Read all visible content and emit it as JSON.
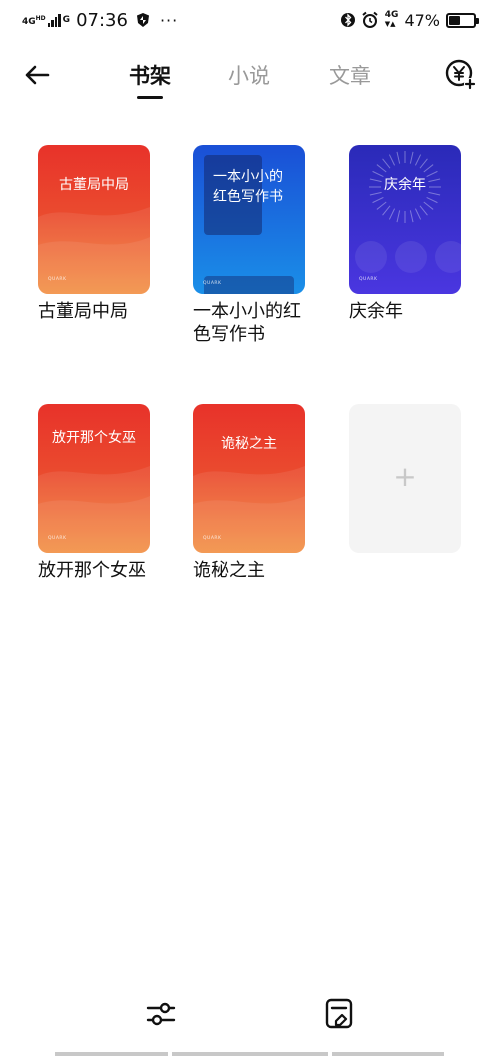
{
  "status_bar": {
    "network": "4G",
    "network_sup": "HD",
    "network2": "G",
    "time": "07:36",
    "dots": "···",
    "net_right": "4G",
    "battery": "47%",
    "battery_level": 0.47
  },
  "header": {
    "tabs": [
      "书架",
      "小说",
      "文章"
    ],
    "active_tab": 0
  },
  "books": [
    {
      "cover_title": "古董局中局",
      "name": "古董局中局",
      "brand": "QUARK",
      "theme": "orange"
    },
    {
      "cover_title": "一本小小的红色写作书",
      "name": "一本小小的红色写作书",
      "brand": "QUARK",
      "theme": "blue"
    },
    {
      "cover_title": "庆余年",
      "name": "庆余年",
      "brand": "QUARK",
      "theme": "purple"
    },
    {
      "cover_title": "放开那个女巫",
      "name": "放开那个女巫",
      "brand": "QUARK",
      "theme": "orange"
    },
    {
      "cover_title": "诡秘之主",
      "name": "诡秘之主",
      "brand": "QUARK",
      "theme": "orange"
    }
  ],
  "add_card": {
    "label": "+"
  },
  "colors": {
    "orange_top": "#e8322a",
    "orange_bottom": "#f28a3a",
    "blue_top": "#1a4fd6",
    "blue_bottom": "#1a8fe8",
    "purple_top": "#2a2ab8",
    "purple_bottom": "#4a36e0"
  }
}
